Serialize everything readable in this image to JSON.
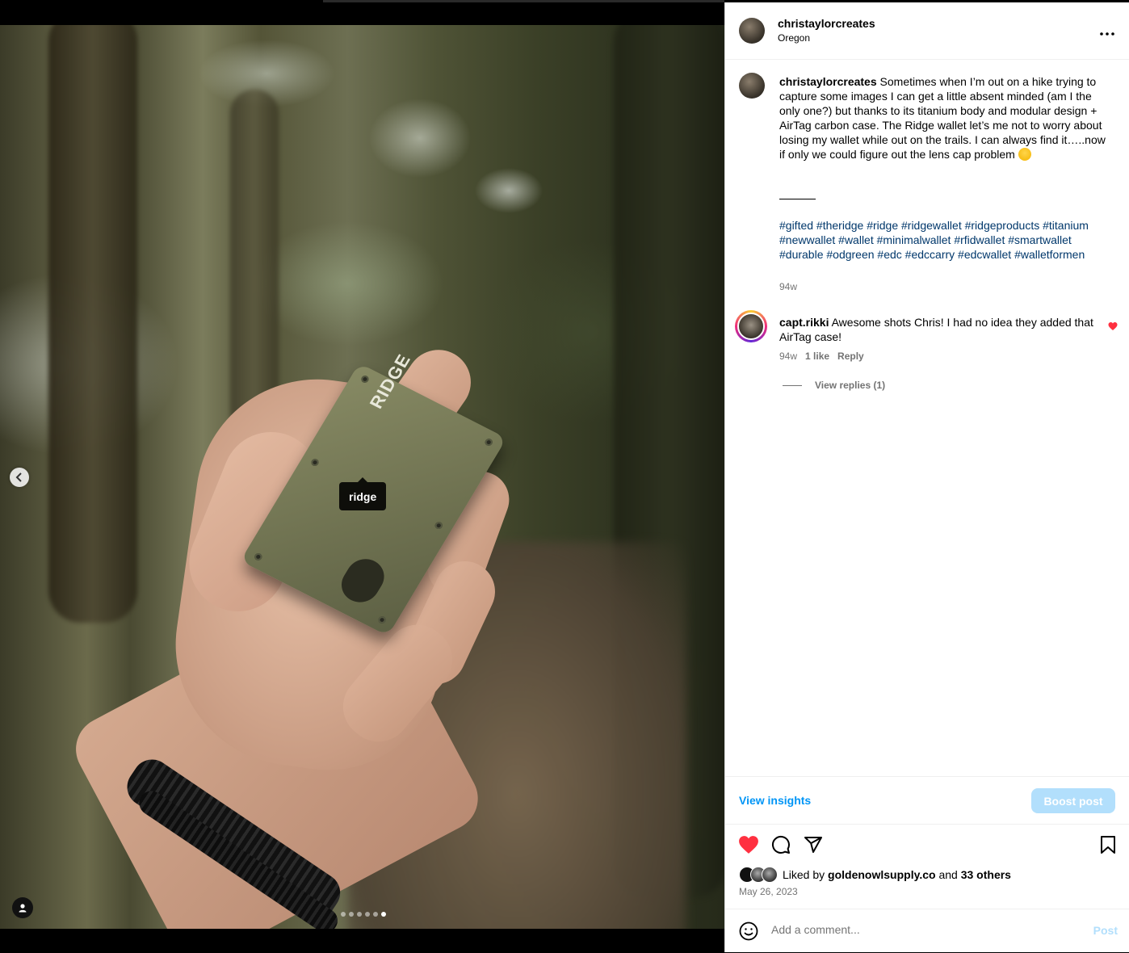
{
  "post": {
    "username": "christaylorcreates",
    "location": "Oregon",
    "more_label": "•••",
    "caption_text": " Sometimes when I’m out on a hike trying to capture some images I can get a little absent minded (am I the only one?) but thanks to its titanium body and modular design + AirTag carbon case. The Ridge wallet let’s me not to worry about losing my wallet while out on the trails. I can always find it…..now if only we could figure out the lens cap problem ",
    "caption_emoji": "grinning-sweat-emoji",
    "separator": "______",
    "hashtags": "#gifted #theridge #ridge #ridgewallet #ridgeproducts #titanium #newwallet #wallet #minimalwallet #rfidwallet #smartwallet #durable #odgreen #edc #edccarry #edcwallet #walletformen",
    "caption_time": "94w",
    "date": "May 26, 2023"
  },
  "media": {
    "tag_label": "ridge",
    "wallet_brand": "RIDGE",
    "slide_count": 6,
    "active_slide": 6
  },
  "comment": {
    "username": "capt.rikki",
    "text": " Awesome shots Chris! I had no idea they added that AirTag case!",
    "time": "94w",
    "likes": "1 like",
    "reply_label": "Reply",
    "view_replies": "View replies (1)",
    "liked": true
  },
  "insights": {
    "view_label": "View insights",
    "boost_label": "Boost post"
  },
  "likes": {
    "prefix": "Liked by ",
    "first_user": "goldenowlsupply.co",
    "and_label": " and ",
    "others": "33 others"
  },
  "add_comment": {
    "placeholder": "Add a comment...",
    "post_label": "Post"
  },
  "colors": {
    "link_blue": "#00376b",
    "accent_blue": "#0095f6",
    "boost_disabled": "#b2dffc",
    "like_red": "#ff3040",
    "muted": "#737373"
  },
  "icons": [
    "chevron-left-icon",
    "user-tag-icon",
    "heart-icon",
    "comment-icon",
    "share-icon",
    "bookmark-icon",
    "emoji-smile-icon",
    "more-icon"
  ]
}
